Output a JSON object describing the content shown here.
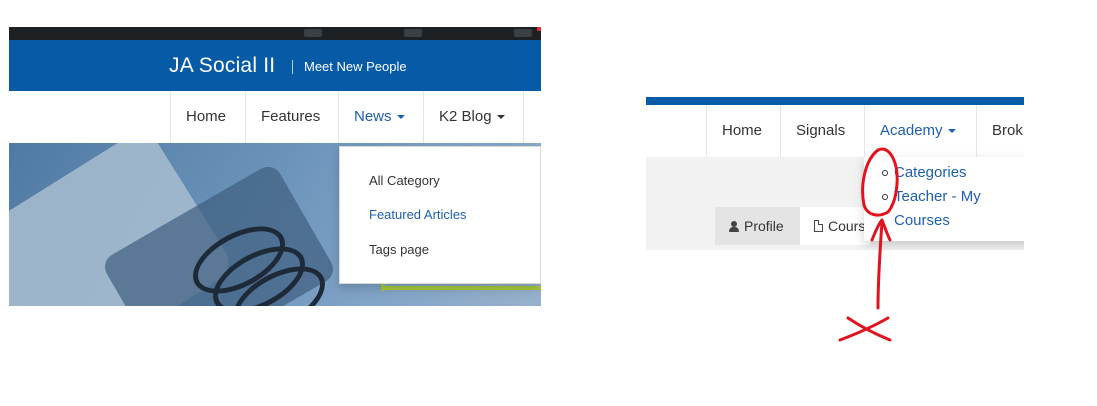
{
  "left_screenshot": {
    "site_title": "JA Social II",
    "tagline": "Meet New People",
    "nav": [
      {
        "label": "Home",
        "active": false,
        "has_caret": false
      },
      {
        "label": "Features",
        "active": false,
        "has_caret": false
      },
      {
        "label": "News",
        "active": true,
        "has_caret": true
      },
      {
        "label": "K2 Blog",
        "active": false,
        "has_caret": true
      }
    ],
    "dropdown": [
      {
        "label": "All Category",
        "active": false
      },
      {
        "label": "Featured Articles",
        "active": true
      },
      {
        "label": "Tags page",
        "active": false
      }
    ]
  },
  "right_screenshot": {
    "nav": [
      {
        "label": "Home",
        "active": false,
        "has_caret": false
      },
      {
        "label": "Signals",
        "active": false,
        "has_caret": false
      },
      {
        "label": "Academy",
        "active": true,
        "has_caret": true
      },
      {
        "label": "Brok",
        "active": false,
        "has_caret": false
      }
    ],
    "dropdown": [
      {
        "label": "Categories"
      },
      {
        "label": "Teacher - My Courses"
      }
    ],
    "tabs": {
      "profile": "Profile",
      "courses": "Cours"
    }
  },
  "colors": {
    "brand_blue": "#075aa6",
    "link_blue": "#1e5fae",
    "annotation_red": "#e0141e"
  }
}
